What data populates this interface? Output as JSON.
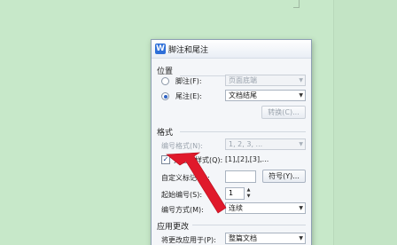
{
  "dialog": {
    "title": "脚注和尾注",
    "icon_text": "W"
  },
  "position": {
    "heading": "位置",
    "footnote_label": "脚注(F):",
    "footnote_value": "页面底端",
    "endnote_label": "尾注(E):",
    "endnote_value": "文档结尾",
    "convert_button": "转换(C)..."
  },
  "format": {
    "heading": "格式",
    "number_format_label": "编号格式(N):",
    "number_format_value": "1, 2, 3, ...",
    "bracket_style_label": "方括号样式(Q):",
    "bracket_style_value": "[1],[2],[3],...",
    "custom_mark_label": "自定义标记(U):",
    "custom_mark_value": "",
    "symbol_button": "符号(Y)...",
    "start_at_label": "起始编号(S):",
    "start_at_value": "1",
    "numbering_label": "编号方式(M):",
    "numbering_value": "连续"
  },
  "apply": {
    "heading": "应用更改",
    "apply_to_label": "将更改应用于(P):",
    "apply_to_value": "整篇文档"
  },
  "colors": {
    "background": "#c7e8c9",
    "arrow": "#e0192b"
  },
  "icons": {
    "dropdown": "chevron-down-icon",
    "pointer": "red-arrow-annotation"
  }
}
